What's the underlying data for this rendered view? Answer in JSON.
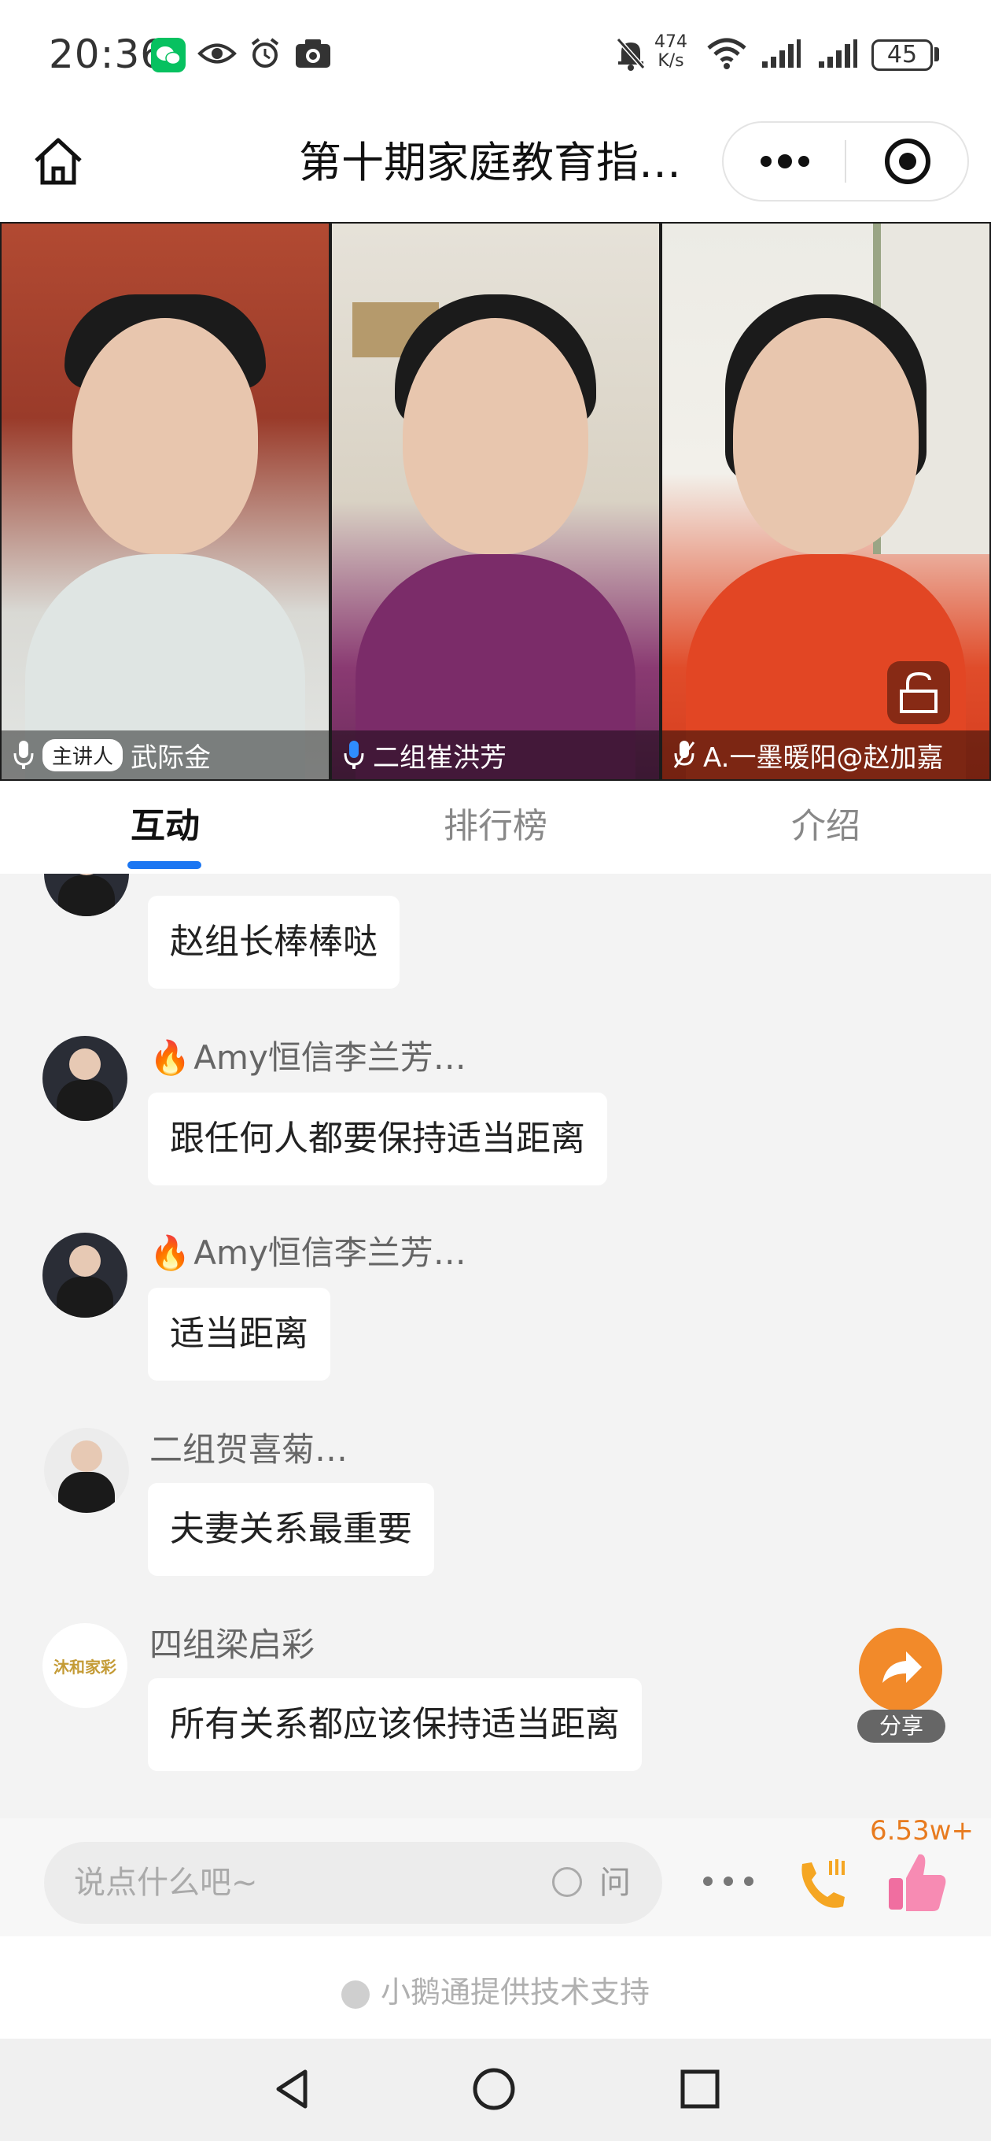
{
  "status_bar": {
    "time": "20:36",
    "net_speed_value": "474",
    "net_speed_unit": "K/s",
    "battery": "45",
    "icons": [
      "wechat-icon",
      "eye-icon",
      "alarm-icon",
      "camera-icon",
      "mute-bell-icon",
      "wifi-icon",
      "signal-icon",
      "signal-icon",
      "battery-icon"
    ]
  },
  "header": {
    "title": "第十期家庭教育指…",
    "more_icon": "more-dots-icon",
    "record_icon": "record-icon",
    "home_icon": "home-icon"
  },
  "video": {
    "participants": [
      {
        "badge": "主讲人",
        "name": "武际金"
      },
      {
        "badge": "",
        "name": "二组崔洪芳"
      },
      {
        "badge": "",
        "name": "A.一墨暖阳@赵加嘉"
      }
    ]
  },
  "tabs": [
    {
      "label": "互动",
      "active": true
    },
    {
      "label": "排行榜",
      "active": false
    },
    {
      "label": "介绍",
      "active": false
    }
  ],
  "chat": {
    "messages": [
      {
        "sender": "",
        "text": "赵组长棒棒哒"
      },
      {
        "sender": "Amy恒信李兰芳…",
        "fire": "🔥",
        "text": "跟任何人都要保持适当距离"
      },
      {
        "sender": "Amy恒信李兰芳…",
        "fire": "🔥",
        "text": "适当距离"
      },
      {
        "sender": "二组贺喜菊…",
        "text": "夫妻关系最重要"
      },
      {
        "sender": "四组梁启彩",
        "text": "所有关系都应该保持适当距离",
        "avatar_logo": "沐和家彩"
      }
    ]
  },
  "share": {
    "label": "分享"
  },
  "input_bar": {
    "placeholder": "说点什么吧~",
    "ask_label": "问",
    "like_count": "6.53w+"
  },
  "footer": {
    "support_text": "小鹅通提供技术支持"
  },
  "colors": {
    "accent_blue": "#1b76f2",
    "like_orange": "#e87b1f",
    "share_orange": "#f28a2a"
  }
}
